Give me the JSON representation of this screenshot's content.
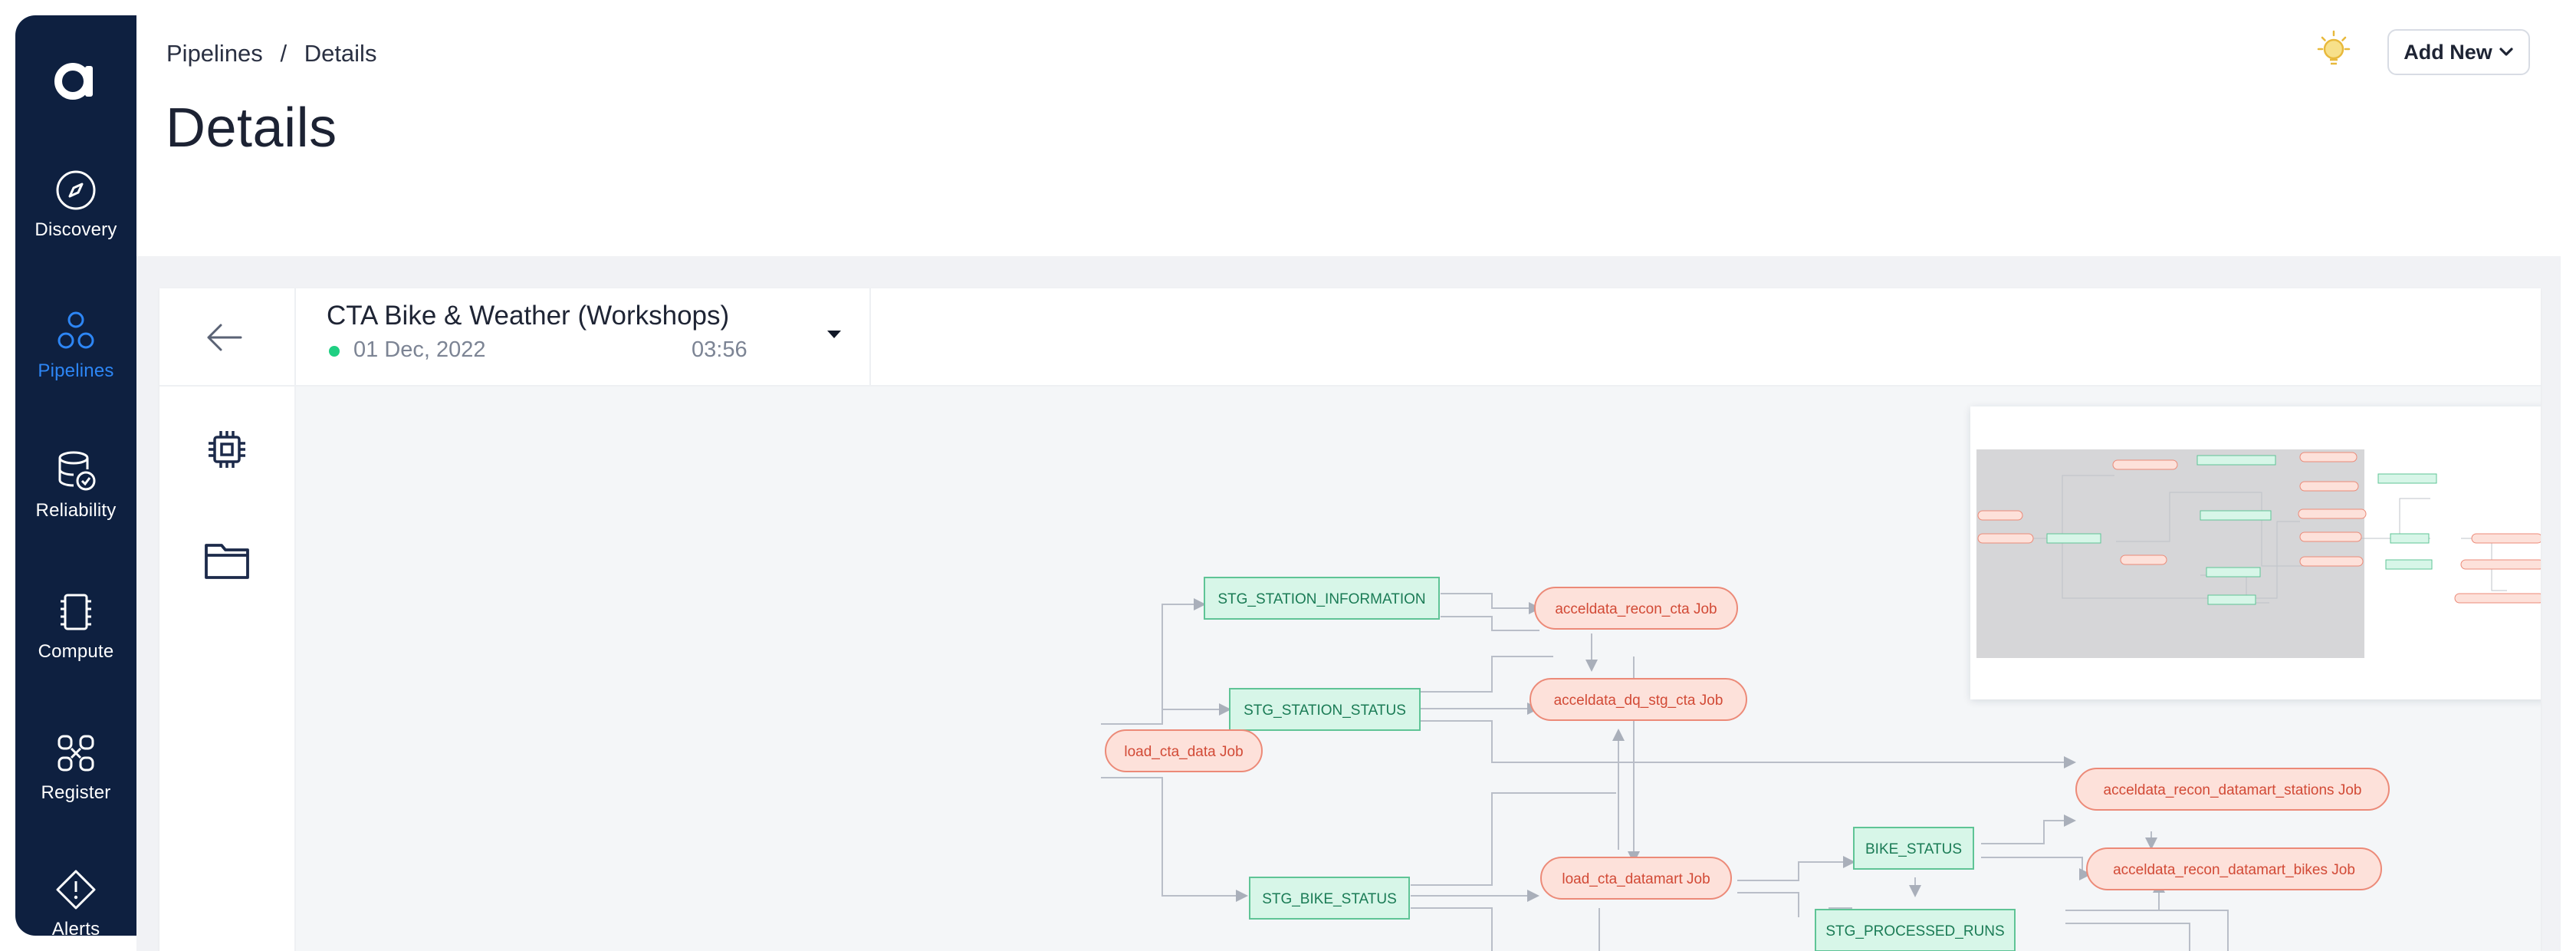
{
  "sidebar": {
    "logo": "a",
    "items": [
      {
        "label": "Discovery",
        "icon": "compass-icon"
      },
      {
        "label": "Pipelines",
        "icon": "pipelines-icon",
        "active": true
      },
      {
        "label": "Reliability",
        "icon": "database-check-icon"
      },
      {
        "label": "Compute",
        "icon": "chip-icon"
      },
      {
        "label": "Register",
        "icon": "register-icon"
      },
      {
        "label": "Alerts",
        "icon": "alert-diamond-icon"
      }
    ]
  },
  "header": {
    "breadcrumb": {
      "root": "Pipelines",
      "separator": "/",
      "current": "Details"
    },
    "title": "Details",
    "theme_icon": "sun-bulb-icon",
    "add_new_label": "Add New"
  },
  "pipeline": {
    "name": "CTA Bike & Weather (Workshops)",
    "status_color": "#1fcf82",
    "date": "01 Dec, 2022",
    "time": "03:56"
  },
  "tools": [
    {
      "icon": "chip-icon"
    },
    {
      "icon": "folder-icon"
    }
  ],
  "graph": {
    "colors": {
      "job_fill": "#fde1da",
      "job_stroke": "#ec8a78",
      "job_text": "#d24a36",
      "table_fill": "#d7f6e8",
      "table_stroke": "#5fc496",
      "table_text": "#1a7b55",
      "edge": "#b9bec8"
    },
    "nodes": [
      {
        "label": "STG_STATION_INFORMATION",
        "kind": "table"
      },
      {
        "label": "acceldata_recon_cta Job",
        "kind": "job"
      },
      {
        "label": "STG_STATION_STATUS",
        "kind": "table"
      },
      {
        "label": "acceldata_dq_stg_cta Job",
        "kind": "job"
      },
      {
        "label": "load_cta_data Job",
        "kind": "job"
      },
      {
        "label": "acceldata_recon_datamart_stations Job",
        "kind": "job"
      },
      {
        "label": "BIKE_STATUS",
        "kind": "table"
      },
      {
        "label": "acceldata_recon_datamart_bikes Job",
        "kind": "job"
      },
      {
        "label": "STG_BIKE_STATUS",
        "kind": "table"
      },
      {
        "label": "load_cta_datamart Job",
        "kind": "job"
      },
      {
        "label": "STG_PROCESSED_RUNS",
        "kind": "table"
      }
    ]
  }
}
